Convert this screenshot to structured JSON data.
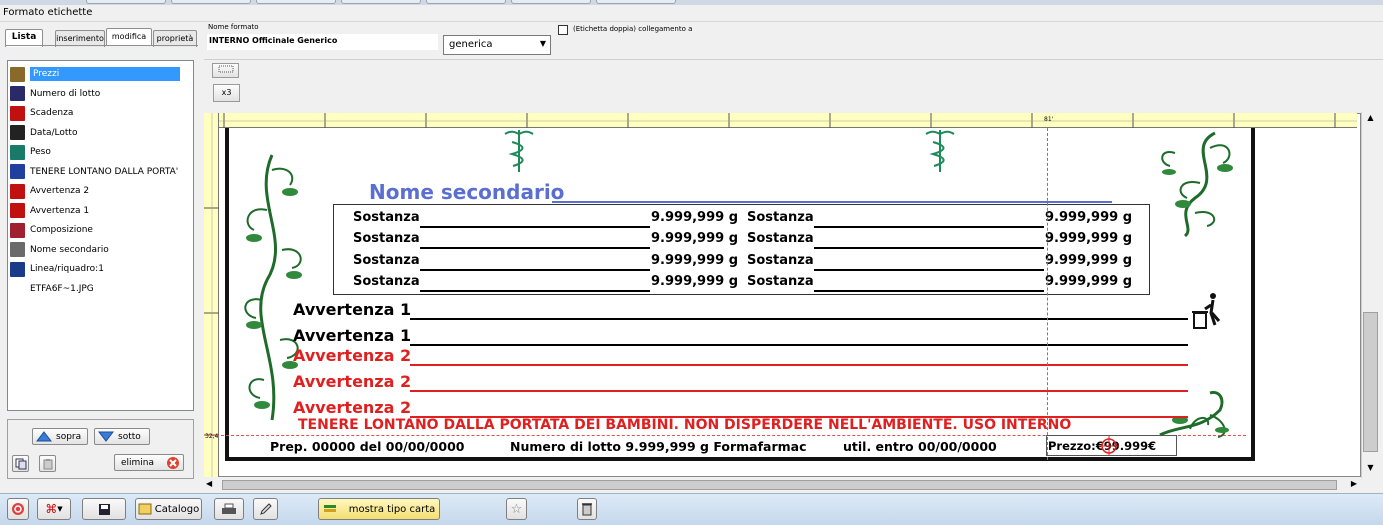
{
  "window": {
    "title": "Formato etichette"
  },
  "tabs": [
    "Lista",
    "inserimento",
    "modifica",
    "proprietà"
  ],
  "list_items": [
    {
      "label": "Prezzi",
      "icon": "price-tag-icon",
      "color": "#8a6a2a"
    },
    {
      "label": "Numero di lotto",
      "icon": "barcode-icon",
      "color": "#2a2a6a"
    },
    {
      "label": "Scadenza",
      "icon": "expiry-icon",
      "color": "#c01010"
    },
    {
      "label": "Data/Lotto",
      "icon": "clock-icon",
      "color": "#222222"
    },
    {
      "label": "Peso",
      "icon": "scale-icon",
      "color": "#1a7a6a"
    },
    {
      "label": "TENERE LONTANO DALLA PORTA'",
      "icon": "children-icon",
      "color": "#2040a0"
    },
    {
      "label": "Avvertenza 2",
      "icon": "warning-icon",
      "color": "#c01010"
    },
    {
      "label": "Avvertenza 1",
      "icon": "warning-icon",
      "color": "#c01010"
    },
    {
      "label": "Composizione",
      "icon": "composition-icon",
      "color": "#a02030"
    },
    {
      "label": "Nome secondario",
      "icon": "secondary-name-icon",
      "color": "#6a6a6a"
    },
    {
      "label": "Linea/riquadro:1",
      "icon": "frame-icon",
      "color": "#1a3a8a"
    },
    {
      "label": "ETFA6F~1.JPG",
      "icon": "image-file-icon",
      "color": "#ffffff"
    }
  ],
  "buttons": {
    "up": "sopra",
    "down": "sotto",
    "delete": "elimina"
  },
  "format": {
    "name_label": "Nome formato",
    "name_value": "INTERNO Officinale Generico",
    "type_value": "generica",
    "double_label": "(Etichetta doppia) collegamento  a",
    "double_checked": false
  },
  "tool_buttons": {
    "multiply": "x3"
  },
  "ruler": {
    "marker": "81'",
    "v1": "32,4"
  },
  "label": {
    "secondary_name": "Nome secondario",
    "substances": [
      {
        "name": "Sostanza",
        "amount": "9.999,999 g"
      },
      {
        "name": "Sostanza",
        "amount": "9.999,999 g"
      },
      {
        "name": "Sostanza",
        "amount": "9.999,999 g"
      },
      {
        "name": "Sostanza",
        "amount": "9.999,999 g"
      },
      {
        "name": "Sostanza",
        "amount": "9.999,999 g"
      },
      {
        "name": "Sostanza",
        "amount": "9.999,999 g"
      },
      {
        "name": "Sostanza",
        "amount": "9.999,999 g"
      },
      {
        "name": "Sostanza",
        "amount": "9.999,999 g"
      }
    ],
    "warnings_black": [
      "Avvertenza 1",
      "Avvertenza 1"
    ],
    "warnings_red": [
      "Avvertenza 2",
      "Avvertenza 2",
      "Avvertenza 2"
    ],
    "keep_away": "TENERE LONTANO DALLA PORTATA DEI BAMBINI. NON DISPERDERE NELL'AMBIENTE. USO INTERNO",
    "prep": "Prep. 00000 del 00/00/0000",
    "lot": "Numero di lotto 9.999,999 g Formafarmac",
    "use_by": "util. entro 00/00/0000",
    "price": "Prezzo:€99.999€"
  },
  "bottom_bar": {
    "catalog": "Catalogo",
    "show_paper": "mostra tipo carta"
  },
  "colors": {
    "secondary_name": "#5b6fd1",
    "warning_red": "#e02020",
    "selection": "#3399ff",
    "ruler": "#ffffc0",
    "leaf_green": "#1e6b2a"
  }
}
